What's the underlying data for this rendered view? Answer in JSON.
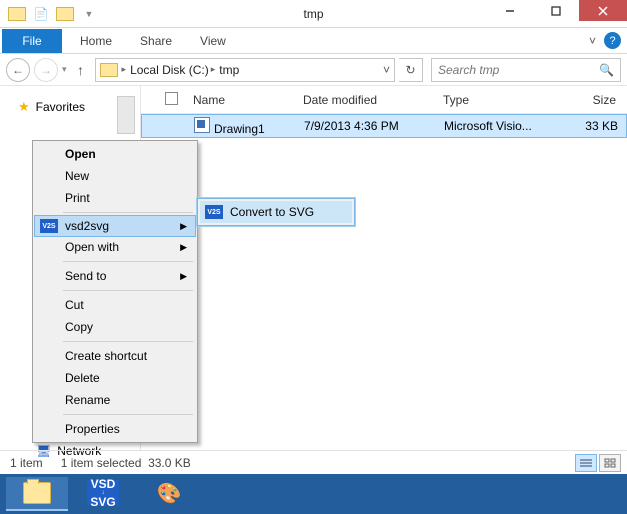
{
  "window": {
    "title": "tmp"
  },
  "ribbon": {
    "file": "File",
    "tabs": [
      "Home",
      "Share",
      "View"
    ]
  },
  "address": {
    "segments": [
      "Local Disk (C:)",
      "tmp"
    ],
    "search_placeholder": "Search tmp"
  },
  "navpane": {
    "favorites": "Favorites",
    "network": "Network"
  },
  "columns": {
    "name": "Name",
    "date": "Date modified",
    "type": "Type",
    "size": "Size"
  },
  "files": [
    {
      "name": "Drawing1",
      "date": "7/9/2013 4:36 PM",
      "type": "Microsoft Visio...",
      "size": "33 KB"
    }
  ],
  "context_menu": {
    "open": "Open",
    "new": "New",
    "print": "Print",
    "vsd2svg": "vsd2svg",
    "open_with": "Open with",
    "send_to": "Send to",
    "cut": "Cut",
    "copy": "Copy",
    "create_shortcut": "Create shortcut",
    "delete": "Delete",
    "rename": "Rename",
    "properties": "Properties"
  },
  "submenu": {
    "convert": "Convert to SVG"
  },
  "status": {
    "count": "1 item",
    "selected": "1 item selected",
    "size": "33.0 KB"
  },
  "icons": {
    "v2s": "V2S",
    "vsd_top": "VSD",
    "vsd_bot": "SVG"
  }
}
